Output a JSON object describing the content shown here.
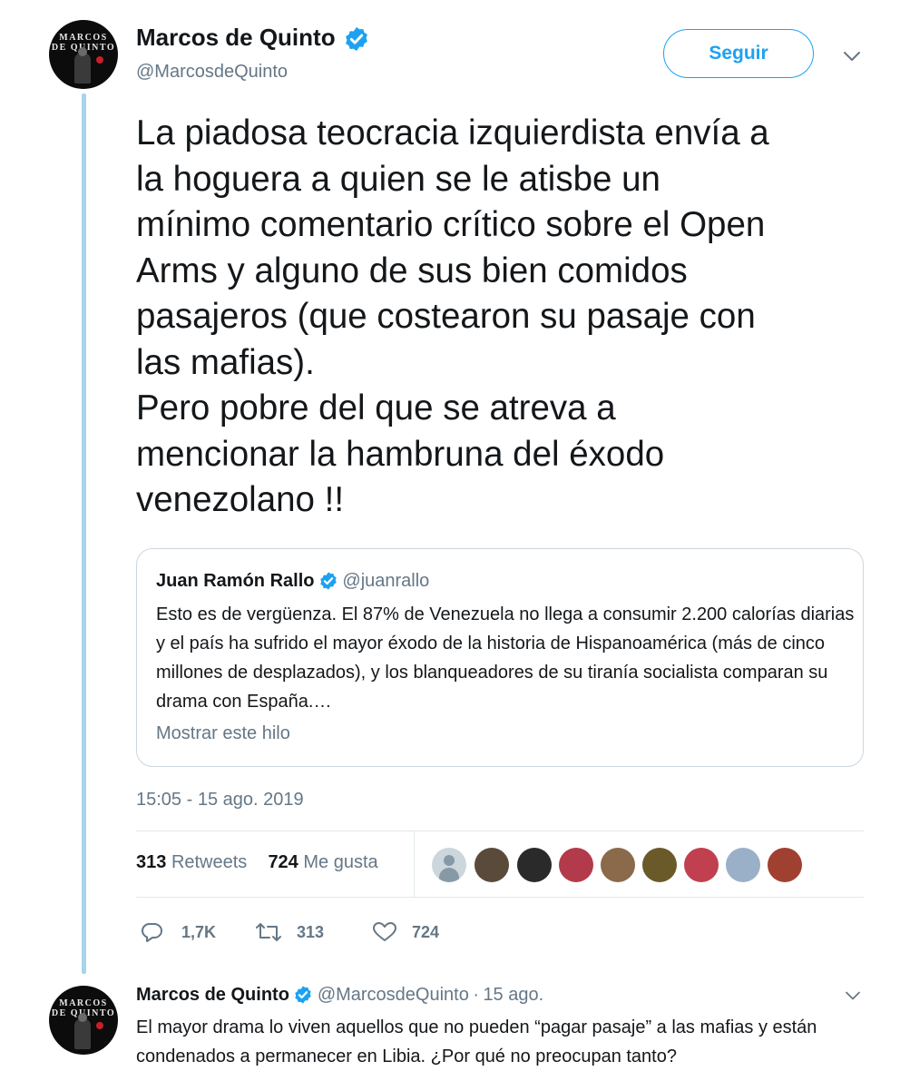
{
  "main_tweet": {
    "author_name": "Marcos de Quinto",
    "author_handle": "@MarcosdeQuinto",
    "avatar_text_line1": "MARCOS",
    "avatar_text_line2": "DE QUINTO",
    "follow_label": "Seguir",
    "text": "La piadosa teocracia izquierdista envía a\nla hoguera a quien se le atisbe un\nmínimo comentario crítico sobre el Open\nArms y alguno de sus bien comidos\npasajeros (que costearon su pasaje con\nlas mafias).\nPero pobre del que se atreva a\nmencionar la hambruna del éxodo\nvenezolano !!",
    "timestamp": "15:05 - 15 ago. 2019",
    "retweets_count": "313",
    "retweets_label": "Retweets",
    "likes_count": "724",
    "likes_label": "Me gusta",
    "actions": {
      "replies": "1,7K",
      "retweets": "313",
      "likes": "724"
    }
  },
  "quoted_tweet": {
    "author_name": "Juan Ramón Rallo",
    "author_handle": "@juanrallo",
    "text": "Esto es de vergüenza. El 87% de Venezuela no llega a consumir 2.200 calorías diarias y el país ha sufrido el mayor éxodo de la historia de Hispanoamérica (más de cinco millones de desplazados), y los blanqueadores de su tiranía socialista comparan su drama con España.…",
    "show_thread_label": "Mostrar este hilo"
  },
  "reply_tweet": {
    "author_name": "Marcos de Quinto",
    "author_handle": "@MarcosdeQuinto",
    "separator": "·",
    "date": "15 ago.",
    "text": "El mayor drama lo viven aquellos que no pueden “pagar pasaje” a las mafias y están condenados a permanecer en Libia. ¿Por qué no preocupan tanto?"
  },
  "likers": [
    {
      "color": "#aab8c2"
    },
    {
      "color": "#5a4a3a"
    },
    {
      "color": "#2a2a2a"
    },
    {
      "color": "#b33a4a"
    },
    {
      "color": "#8a6a4a"
    },
    {
      "color": "#6a5a2a"
    },
    {
      "color": "#c04050"
    },
    {
      "color": "#9ab0c8"
    },
    {
      "color": "#a04030"
    }
  ],
  "colors": {
    "accent": "#1da1f2",
    "verified": "#1da1f2",
    "muted": "#657786",
    "thread_line": "#a7d4ea"
  }
}
